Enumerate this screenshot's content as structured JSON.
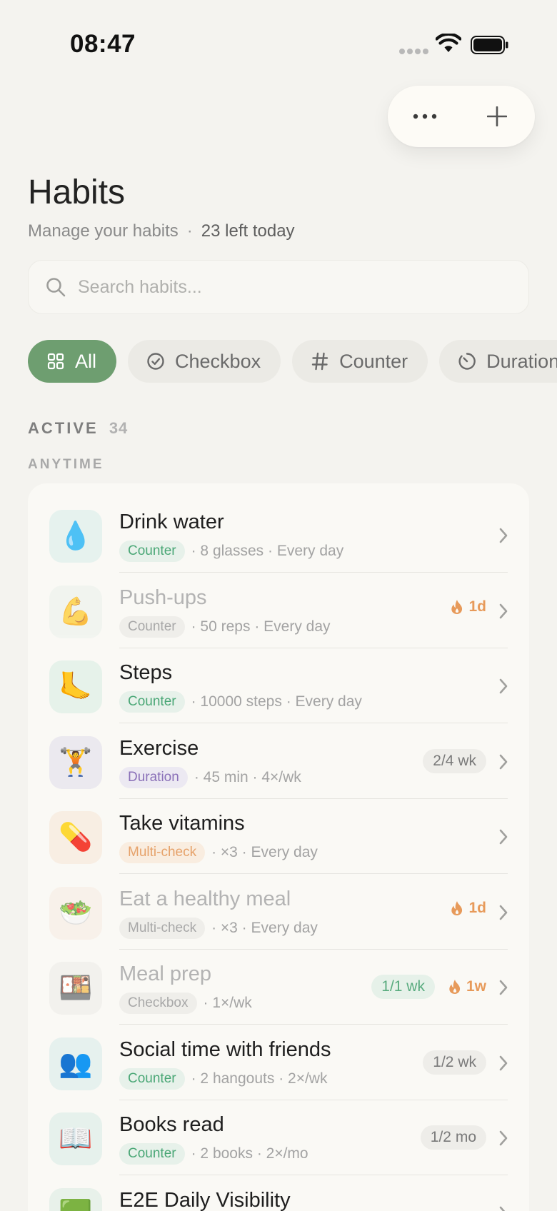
{
  "status_bar": {
    "time": "08:47"
  },
  "header": {
    "title": "Habits",
    "subtitle": "Manage your habits",
    "left_today": "23 left today"
  },
  "search": {
    "placeholder": "Search habits..."
  },
  "filters": [
    {
      "label": "All",
      "icon": "grid-icon",
      "active": true
    },
    {
      "label": "Checkbox",
      "icon": "check-circle-icon",
      "active": false
    },
    {
      "label": "Counter",
      "icon": "hash-icon",
      "active": false
    },
    {
      "label": "Duration",
      "icon": "timer-icon",
      "active": false
    }
  ],
  "section": {
    "label": "ACTIVE",
    "count": "34",
    "group": "ANYTIME"
  },
  "habits": [
    {
      "name": "Drink water",
      "emoji": "💧",
      "tile_color": "#e6f2ee",
      "type": "Counter",
      "type_style": "counter",
      "detail": "· 8 glasses · Every day",
      "done": false
    },
    {
      "name": "Push-ups",
      "emoji": "💪",
      "tile_color": "#eef3ee",
      "type": "Counter",
      "type_style": "grey",
      "detail": "· 50 reps · Every day",
      "done": true,
      "streak": "1d"
    },
    {
      "name": "Steps",
      "emoji": "🦶",
      "tile_color": "#e6f2ea",
      "type": "Counter",
      "type_style": "counter",
      "detail": "· 10000 steps · Every day",
      "done": false
    },
    {
      "name": "Exercise",
      "emoji": "🏋️",
      "tile_color": "#ebe9ef",
      "type": "Duration",
      "type_style": "duration",
      "detail": "· 45 min · 4×/wk",
      "done": false,
      "progress": "2/4 wk"
    },
    {
      "name": "Take vitamins",
      "emoji": "💊",
      "tile_color": "#f8eee3",
      "type": "Multi-check",
      "type_style": "multi",
      "detail": "· ×3 · Every day",
      "done": false
    },
    {
      "name": "Eat a healthy meal",
      "emoji": "🥗",
      "tile_color": "#f8efe6",
      "type": "Multi-check",
      "type_style": "grey",
      "detail": "· ×3 · Every day",
      "done": true,
      "streak": "1d"
    },
    {
      "name": "Meal prep",
      "emoji": "🍱",
      "tile_color": "#efeeea",
      "type": "Checkbox",
      "type_style": "grey",
      "detail": "· 1×/wk",
      "done": true,
      "progress": "1/1 wk",
      "progress_style": "green",
      "streak": "1w"
    },
    {
      "name": "Social time with friends",
      "emoji": "👥",
      "tile_color": "#e6f1ee",
      "type": "Counter",
      "type_style": "counter",
      "detail": "· 2 hangouts · 2×/wk",
      "done": false,
      "progress": "1/2 wk"
    },
    {
      "name": "Books read",
      "emoji": "📖",
      "tile_color": "#e6f1ec",
      "type": "Counter",
      "type_style": "counter",
      "detail": "· 2 books · 2×/mo",
      "done": false,
      "progress": "1/2 mo"
    },
    {
      "name": "E2E Daily Visibility",
      "emoji": "🟩",
      "tile_color": "#e8f1ea",
      "type": "",
      "type_style": "counter",
      "detail": "",
      "done": false
    }
  ]
}
